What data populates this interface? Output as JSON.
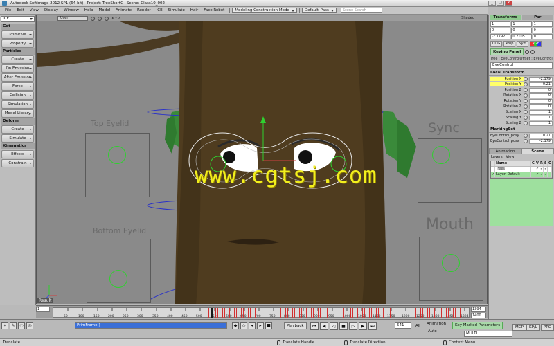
{
  "window": {
    "app_title": "Autodesk Softimage 2012 SP1 (64-bit)",
    "project": "Project: TreeShortC",
    "scene": "Scene: Class10_002"
  },
  "menubar": {
    "items": [
      "File",
      "Edit",
      "View",
      "Display",
      "Window",
      "Help",
      "Model",
      "Animate",
      "Render",
      "ICE",
      "Simulate",
      "Hair",
      "Face Robot"
    ],
    "construction_mode": "Modeling Construction Mode",
    "pass": "Default_Pass",
    "search_placeholder": "Scene Search"
  },
  "left_panel": {
    "toolbar_selector": "ICE",
    "sections": [
      {
        "header": "Get",
        "buttons": [
          "Primitive",
          "Property"
        ]
      },
      {
        "header": "Particles",
        "buttons": [
          "Create",
          "On Emission",
          "After Emission",
          "Force",
          "Collision",
          "Simulation",
          "Model Library"
        ]
      },
      {
        "header": "Deform",
        "buttons": [
          "Create",
          "Simulate"
        ]
      },
      {
        "header": "Kinematics",
        "buttons": [
          "Effects",
          "Constrain"
        ]
      }
    ]
  },
  "viewport": {
    "camera": "User",
    "axes": "X Y Z",
    "shading": "Shaded",
    "labels": {
      "top_eyelid": "Top Eyelid",
      "bottom_eyelid": "Bottom Eyelid",
      "sync": "Sync",
      "mouth": "Mouth"
    },
    "watermark": "www.cgtsj.com",
    "result_label": "Result",
    "colors": {
      "trunk": "#4f3c1f",
      "foliage": "#3a8a3a",
      "rig_green": "#2fd02f",
      "guide_blue": "#2a32c8"
    }
  },
  "right_panel": {
    "tabs": [
      "Transforms",
      "Par"
    ],
    "transform_values": [
      [
        "1",
        "1",
        "1"
      ],
      [
        "0",
        "0",
        "0"
      ],
      [
        "-2.1792",
        "0.2105",
        "0"
      ]
    ],
    "mini_buttons": [
      "COG",
      "Prop",
      "Sym",
      "RGB"
    ],
    "keying_panel": "Keying Panel",
    "path": "Tree : EyeControlOffset : EyeControl",
    "object_name": "EyeControl",
    "local_transform": {
      "title": "Local Transform",
      "params": [
        {
          "name": "Position X",
          "value": "-2.179",
          "animated": true
        },
        {
          "name": "Position Y",
          "value": "0.21",
          "animated": true
        },
        {
          "name": "Position Z",
          "value": "0",
          "animated": false
        },
        {
          "name": "Rotation X",
          "value": "0",
          "animated": false
        },
        {
          "name": "Rotation Y",
          "value": "0",
          "animated": false
        },
        {
          "name": "Rotation Z",
          "value": "0",
          "animated": false
        },
        {
          "name": "Scaling X",
          "value": "1",
          "animated": false
        },
        {
          "name": "Scaling Y",
          "value": "1",
          "animated": false
        },
        {
          "name": "Scaling Z",
          "value": "1",
          "animated": false
        }
      ]
    },
    "marking_set": {
      "title": "MarkingSet",
      "params": [
        {
          "name": "EyeControl_posy",
          "value": "0.21"
        },
        {
          "name": "EyeControl_posx",
          "value": "-2.179"
        }
      ]
    },
    "bottom_tabs": [
      "Animation",
      "Scene"
    ],
    "layers_menu": [
      "Layers",
      "View"
    ],
    "layer_columns": [
      "Name",
      "C",
      "V",
      "R",
      "S",
      "O"
    ],
    "layers": [
      "Trees",
      "Layer_Default"
    ]
  },
  "timeline": {
    "start": "1",
    "end_top": "1394",
    "end_bottom": "1400",
    "ticks": [
      "50",
      "100",
      "150",
      "200",
      "250",
      "300",
      "350",
      "400",
      "450",
      "500",
      "550",
      "600",
      "650",
      "700",
      "750",
      "800",
      "850",
      "900",
      "950",
      "1000",
      "1050",
      "1100",
      "1150",
      "1200",
      "1250",
      "1300",
      "1350",
      "1394"
    ]
  },
  "bottom_toolbar": {
    "frame_field": "PrimFrame()",
    "playback": "Playback",
    "current_frame": "541",
    "all_label": "All",
    "animation_label": "Animation",
    "auto_label": "Auto",
    "key_marked": "Key Marked Parameters",
    "multi_field": "MULTI",
    "modes": [
      "MCP",
      "KP/L",
      "PPG"
    ]
  },
  "status_bar": {
    "left": "Translate",
    "mid1": "Translate Handle",
    "mid2": "Translate Direction",
    "right": "Context Menu"
  }
}
